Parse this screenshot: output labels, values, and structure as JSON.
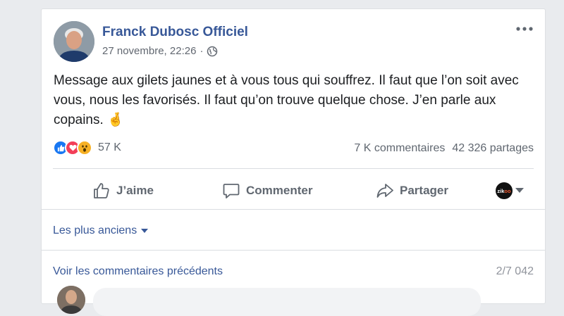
{
  "post": {
    "author": "Franck Dubosc Officiel",
    "timestamp": "27 novembre, 22:26",
    "separator": "·",
    "audience_icon": "globe-icon",
    "text": "Message aux gilets jaunes et à vous tous qui souffrez. Il faut que l’on soit avec vous, nous les favorisés. Il faut qu’on trouve quelque chose. J’en parle aux copains. 🤞"
  },
  "stats": {
    "reaction_icons": [
      "like-icon",
      "love-icon",
      "wow-icon"
    ],
    "reaction_count": "57 K",
    "comments": "7 K commentaires",
    "shares": "42 326 partages"
  },
  "actions": {
    "like": "J’aime",
    "comment": "Commenter",
    "share": "Partager",
    "page_badge_text": "zikoo"
  },
  "comments": {
    "sort_label": "Les plus anciens",
    "view_previous": "Voir les commentaires précédents",
    "count": "2/7 042"
  },
  "colors": {
    "link": "#385898",
    "secondary_text": "#606770",
    "like_blue": "#1877f2",
    "love_red": "#f33e58",
    "wow_yellow": "#f7b125"
  }
}
